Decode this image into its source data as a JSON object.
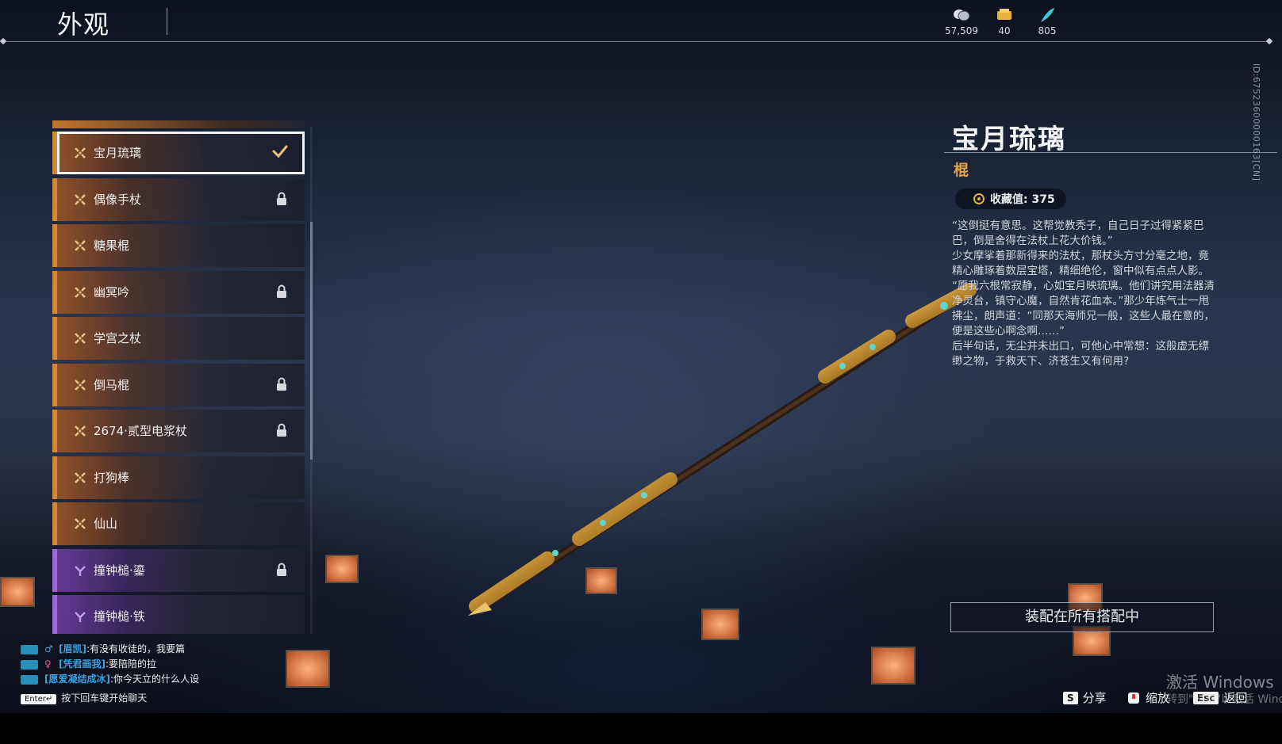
{
  "header": {
    "title": "外观",
    "currencies": [
      {
        "icon": "coin-icon",
        "value": "57,509"
      },
      {
        "icon": "ticket-icon",
        "value": "40"
      },
      {
        "icon": "feather-icon",
        "value": "805"
      }
    ]
  },
  "list": {
    "items": [
      {
        "label": "宝月琉璃",
        "rarity": "orange",
        "state": "equipped"
      },
      {
        "label": "偶像手杖",
        "rarity": "orange",
        "state": "locked"
      },
      {
        "label": "糖果棍",
        "rarity": "orange",
        "state": "none"
      },
      {
        "label": "幽冥吟",
        "rarity": "orange",
        "state": "locked"
      },
      {
        "label": "学宫之杖",
        "rarity": "orange",
        "state": "none"
      },
      {
        "label": "倒马棍",
        "rarity": "orange",
        "state": "locked"
      },
      {
        "label": "2674·贰型电浆杖",
        "rarity": "orange",
        "state": "locked"
      },
      {
        "label": "打狗棒",
        "rarity": "orange",
        "state": "none"
      },
      {
        "label": "仙山",
        "rarity": "orange",
        "state": "none"
      },
      {
        "label": "撞钟槌·鎏",
        "rarity": "purple",
        "state": "locked"
      },
      {
        "label": "撞钟槌·铁",
        "rarity": "purple",
        "state": "none"
      }
    ]
  },
  "detail": {
    "name": "宝月琉璃",
    "type": "棍",
    "collect_label": "收藏值: 375",
    "description": [
      "“这倒挺有意思。这帮觉教秃子，自己日子过得紧紧巴巴，倒是舍得在法杖上花大价钱。”",
      "少女摩挲着那新得来的法杖，那杖头方寸分毫之地，竟精心雕琢着数层宝塔，精细绝伦，窗中似有点点人影。",
      "“愿我六根常寂静，心如宝月映琉璃。他们讲究用法器清净灵台，镇守心魔，自然肯花血本。”那少年炼气士一甩拂尘，朗声道：“同那天海师兄一般，这些人最在意的，便是这些心啊念啊……”",
      "后半句话，无尘并未出口，可他心中常想：这般虚无缥缈之物，于救天下、济苍生又有何用?"
    ],
    "equip_button": "装配在所有搭配中",
    "id_text": "ID:67523600000163[CN]"
  },
  "chat": {
    "messages": [
      {
        "gender": "♂",
        "name": "[眉凯]",
        "text": ":有没有收徒的，我要篇"
      },
      {
        "gender": "♀",
        "name": "[凭君画我]",
        "text": ":要陪陪的拉"
      },
      {
        "gender": "",
        "name": "[愿爱凝结成冰]",
        "text": ":你今天立的什么人设"
      }
    ],
    "enter_key": "Enter↵",
    "enter_hint": "按下回车键开始聊天"
  },
  "keys": {
    "share_key": "S",
    "share_label": "分享",
    "zoom_label": "缩放",
    "back_key": "Esc",
    "back_label": "返回"
  },
  "watermark": {
    "line1": "激活 Windows",
    "line2": "转到\"设置\"以激活 Windows"
  },
  "colors": {
    "accent_orange": "#d08a3a",
    "accent_purple": "#9a6ad8",
    "type_color": "#e0a24a",
    "chat_name": "#3aa0e0"
  }
}
